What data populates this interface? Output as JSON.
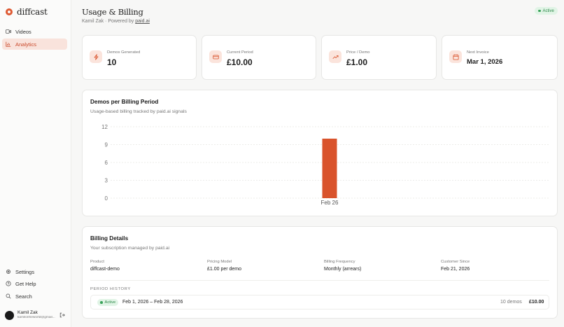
{
  "brand": {
    "name": "diffcast"
  },
  "sidebar": {
    "nav": [
      {
        "label": "Videos",
        "icon": "video-icon"
      },
      {
        "label": "Analytics",
        "icon": "chart-icon"
      }
    ],
    "footer_nav": [
      {
        "label": "Settings",
        "icon": "gear-icon"
      },
      {
        "label": "Get Help",
        "icon": "help-icon"
      },
      {
        "label": "Search",
        "icon": "search-icon"
      }
    ],
    "user": {
      "name": "Kamil Zak",
      "email": "kamilonheworld@gmail..."
    }
  },
  "header": {
    "title": "Usage & Billing",
    "subtitle_prefix": "Kamil Zak · Powered by",
    "subtitle_link": "paid.ai",
    "status": "Active"
  },
  "stats": [
    {
      "label": "Demos Generated",
      "value": "10",
      "icon": "bolt-icon"
    },
    {
      "label": "Current Period",
      "value": "£10.00",
      "icon": "card-icon"
    },
    {
      "label": "Price / Demo",
      "value": "£1.00",
      "icon": "trend-icon"
    },
    {
      "label": "Next Invoice",
      "value": "Mar 1, 2026",
      "icon": "calendar-icon"
    }
  ],
  "chart_card": {
    "title": "Demos per Billing Period",
    "subtitle": "Usage-based billing tracked by paid.ai signals"
  },
  "chart_data": {
    "type": "bar",
    "categories": [
      "Feb 26"
    ],
    "values": [
      10
    ],
    "ylim": [
      0,
      12
    ],
    "yticks": [
      "12",
      "9",
      "6",
      "3",
      "0"
    ],
    "grid": true,
    "bar_color": "#d9532c"
  },
  "billing": {
    "title": "Billing Details",
    "subtitle": "Your subscription managed by paid.ai",
    "fields": [
      {
        "label": "Product",
        "value": "diffcast-demo"
      },
      {
        "label": "Pricing Model",
        "value": "£1.00 per demo"
      },
      {
        "label": "Billing Frequency",
        "value": "Monthly (arrears)"
      },
      {
        "label": "Customer Since",
        "value": "Feb 21, 2026"
      }
    ],
    "period_history_label": "PERIOD HISTORY",
    "periods": [
      {
        "status": "Active",
        "dates": "Feb 1, 2026 – Feb 28, 2026",
        "count": "10 demos",
        "amount": "£10.00"
      }
    ]
  },
  "colors": {
    "accent": "#de5a33",
    "active_green": "#2e8a4a"
  }
}
